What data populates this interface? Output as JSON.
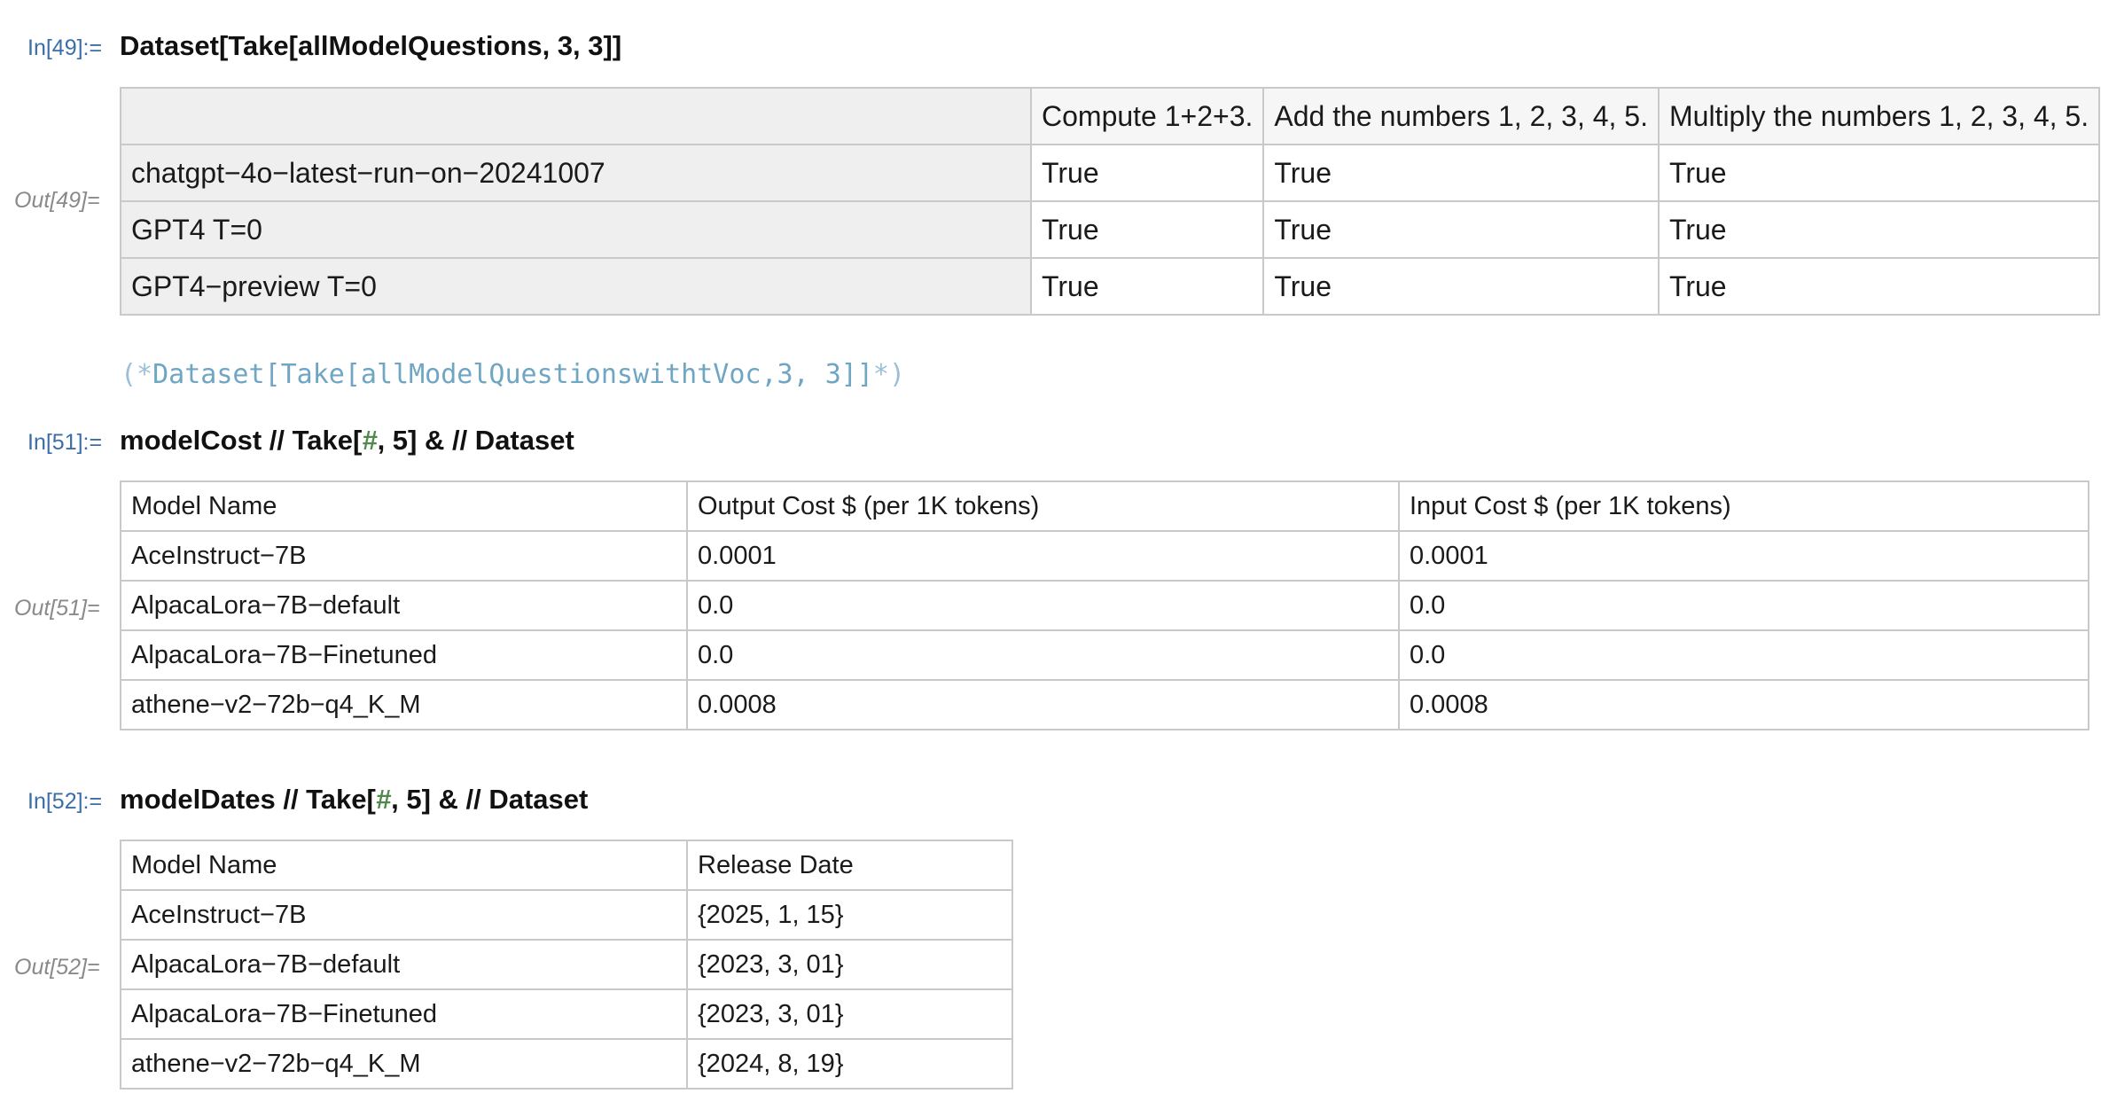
{
  "cells": [
    {
      "in_label": "In[49]:=",
      "out_label": "Out[49]=",
      "input": "Dataset[Take[allModelQuestions, 3,  3]]",
      "table": {
        "columns": [
          "",
          "Compute 1+2+3.",
          "Add the numbers 1, 2, 3, 4, 5.",
          "Multiply the numbers 1, 2, 3, 4, 5."
        ],
        "rows": [
          [
            "chatgpt−4o−latest−run−on−20241007",
            "True",
            "True",
            "True"
          ],
          [
            "GPT4 T=0",
            "True",
            "True",
            "True"
          ],
          [
            "GPT4−preview T=0",
            "True",
            "True",
            "True"
          ]
        ]
      }
    },
    {
      "comment": {
        "open": "(*",
        "code": "Dataset[Take[allModelQuestionswithtVoc,3, 3]]",
        "close": "*)"
      }
    },
    {
      "in_label": "In[51]:=",
      "out_label": "Out[51]=",
      "input_parts": [
        "modelCost // Take[",
        "#",
        ", 5] & // Dataset"
      ],
      "table": {
        "columns": [
          "Model Name",
          "Output Cost $ (per 1K tokens)",
          "Input Cost $ (per 1K tokens)"
        ],
        "rows": [
          [
            "AceInstruct−7B",
            "0.0001",
            "0.0001"
          ],
          [
            "AlpacaLora−7B−default",
            "0.0",
            "0.0"
          ],
          [
            "AlpacaLora−7B−Finetuned",
            "0.0",
            "0.0"
          ],
          [
            "athene−v2−72b−q4_K_M",
            "0.0008",
            "0.0008"
          ]
        ]
      }
    },
    {
      "in_label": "In[52]:=",
      "out_label": "Out[52]=",
      "input_parts": [
        "modelDates // Take[",
        "#",
        ", 5] & // Dataset"
      ],
      "table": {
        "columns": [
          "Model Name",
          "Release Date"
        ],
        "rows": [
          [
            "AceInstruct−7B",
            "{2025, 1, 15}"
          ],
          [
            "AlpacaLora−7B−default",
            "{2023, 3, 01}"
          ],
          [
            "AlpacaLora−7B−Finetuned",
            "{2023, 3, 01}"
          ],
          [
            "athene−v2−72b−q4_K_M",
            "{2024, 8, 19}"
          ]
        ]
      }
    }
  ]
}
